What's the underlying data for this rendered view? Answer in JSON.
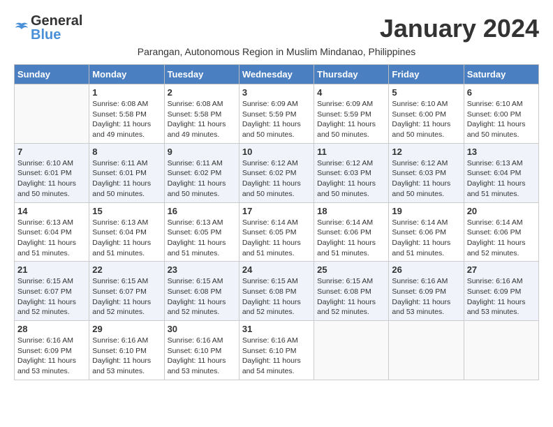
{
  "header": {
    "logo_general": "General",
    "logo_blue": "Blue",
    "month_title": "January 2024",
    "subtitle": "Parangan, Autonomous Region in Muslim Mindanao, Philippines"
  },
  "days_of_week": [
    "Sunday",
    "Monday",
    "Tuesday",
    "Wednesday",
    "Thursday",
    "Friday",
    "Saturday"
  ],
  "weeks": [
    [
      {
        "day": "",
        "info": ""
      },
      {
        "day": "1",
        "info": "Sunrise: 6:08 AM\nSunset: 5:58 PM\nDaylight: 11 hours\nand 49 minutes."
      },
      {
        "day": "2",
        "info": "Sunrise: 6:08 AM\nSunset: 5:58 PM\nDaylight: 11 hours\nand 49 minutes."
      },
      {
        "day": "3",
        "info": "Sunrise: 6:09 AM\nSunset: 5:59 PM\nDaylight: 11 hours\nand 50 minutes."
      },
      {
        "day": "4",
        "info": "Sunrise: 6:09 AM\nSunset: 5:59 PM\nDaylight: 11 hours\nand 50 minutes."
      },
      {
        "day": "5",
        "info": "Sunrise: 6:10 AM\nSunset: 6:00 PM\nDaylight: 11 hours\nand 50 minutes."
      },
      {
        "day": "6",
        "info": "Sunrise: 6:10 AM\nSunset: 6:00 PM\nDaylight: 11 hours\nand 50 minutes."
      }
    ],
    [
      {
        "day": "7",
        "info": "Sunrise: 6:10 AM\nSunset: 6:01 PM\nDaylight: 11 hours\nand 50 minutes."
      },
      {
        "day": "8",
        "info": "Sunrise: 6:11 AM\nSunset: 6:01 PM\nDaylight: 11 hours\nand 50 minutes."
      },
      {
        "day": "9",
        "info": "Sunrise: 6:11 AM\nSunset: 6:02 PM\nDaylight: 11 hours\nand 50 minutes."
      },
      {
        "day": "10",
        "info": "Sunrise: 6:12 AM\nSunset: 6:02 PM\nDaylight: 11 hours\nand 50 minutes."
      },
      {
        "day": "11",
        "info": "Sunrise: 6:12 AM\nSunset: 6:03 PM\nDaylight: 11 hours\nand 50 minutes."
      },
      {
        "day": "12",
        "info": "Sunrise: 6:12 AM\nSunset: 6:03 PM\nDaylight: 11 hours\nand 50 minutes."
      },
      {
        "day": "13",
        "info": "Sunrise: 6:13 AM\nSunset: 6:04 PM\nDaylight: 11 hours\nand 51 minutes."
      }
    ],
    [
      {
        "day": "14",
        "info": "Sunrise: 6:13 AM\nSunset: 6:04 PM\nDaylight: 11 hours\nand 51 minutes."
      },
      {
        "day": "15",
        "info": "Sunrise: 6:13 AM\nSunset: 6:04 PM\nDaylight: 11 hours\nand 51 minutes."
      },
      {
        "day": "16",
        "info": "Sunrise: 6:13 AM\nSunset: 6:05 PM\nDaylight: 11 hours\nand 51 minutes."
      },
      {
        "day": "17",
        "info": "Sunrise: 6:14 AM\nSunset: 6:05 PM\nDaylight: 11 hours\nand 51 minutes."
      },
      {
        "day": "18",
        "info": "Sunrise: 6:14 AM\nSunset: 6:06 PM\nDaylight: 11 hours\nand 51 minutes."
      },
      {
        "day": "19",
        "info": "Sunrise: 6:14 AM\nSunset: 6:06 PM\nDaylight: 11 hours\nand 51 minutes."
      },
      {
        "day": "20",
        "info": "Sunrise: 6:14 AM\nSunset: 6:06 PM\nDaylight: 11 hours\nand 52 minutes."
      }
    ],
    [
      {
        "day": "21",
        "info": "Sunrise: 6:15 AM\nSunset: 6:07 PM\nDaylight: 11 hours\nand 52 minutes."
      },
      {
        "day": "22",
        "info": "Sunrise: 6:15 AM\nSunset: 6:07 PM\nDaylight: 11 hours\nand 52 minutes."
      },
      {
        "day": "23",
        "info": "Sunrise: 6:15 AM\nSunset: 6:08 PM\nDaylight: 11 hours\nand 52 minutes."
      },
      {
        "day": "24",
        "info": "Sunrise: 6:15 AM\nSunset: 6:08 PM\nDaylight: 11 hours\nand 52 minutes."
      },
      {
        "day": "25",
        "info": "Sunrise: 6:15 AM\nSunset: 6:08 PM\nDaylight: 11 hours\nand 52 minutes."
      },
      {
        "day": "26",
        "info": "Sunrise: 6:16 AM\nSunset: 6:09 PM\nDaylight: 11 hours\nand 53 minutes."
      },
      {
        "day": "27",
        "info": "Sunrise: 6:16 AM\nSunset: 6:09 PM\nDaylight: 11 hours\nand 53 minutes."
      }
    ],
    [
      {
        "day": "28",
        "info": "Sunrise: 6:16 AM\nSunset: 6:09 PM\nDaylight: 11 hours\nand 53 minutes."
      },
      {
        "day": "29",
        "info": "Sunrise: 6:16 AM\nSunset: 6:10 PM\nDaylight: 11 hours\nand 53 minutes."
      },
      {
        "day": "30",
        "info": "Sunrise: 6:16 AM\nSunset: 6:10 PM\nDaylight: 11 hours\nand 53 minutes."
      },
      {
        "day": "31",
        "info": "Sunrise: 6:16 AM\nSunset: 6:10 PM\nDaylight: 11 hours\nand 54 minutes."
      },
      {
        "day": "",
        "info": ""
      },
      {
        "day": "",
        "info": ""
      },
      {
        "day": "",
        "info": ""
      }
    ]
  ]
}
